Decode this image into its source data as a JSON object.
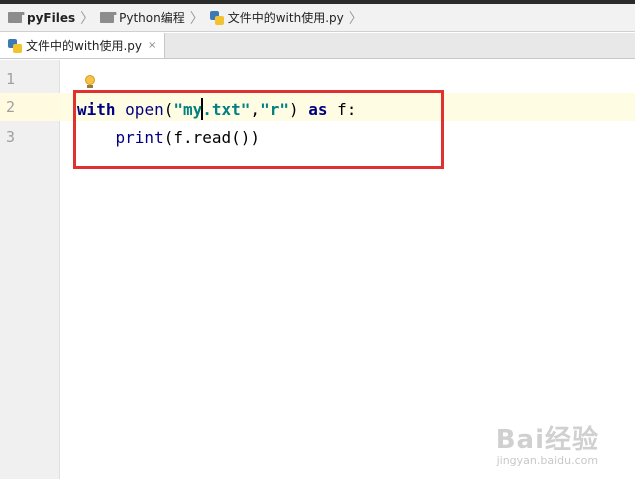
{
  "breadcrumb": {
    "items": [
      {
        "label": "pyFiles",
        "icon": "folder-icon"
      },
      {
        "label": "Python编程",
        "icon": "folder-icon"
      },
      {
        "label": "文件中的with使用.py",
        "icon": "python-file-icon"
      }
    ]
  },
  "tabs": [
    {
      "label": "文件中的with使用.py",
      "close": "×"
    }
  ],
  "editor": {
    "line_numbers": [
      "1",
      "2",
      "3"
    ],
    "line2": {
      "kw_with": "with",
      "fn_open": "open",
      "paren_open": "(",
      "str_part1": "\"my",
      "str_part2": ".txt\"",
      "comma": ",",
      "str_mode": "\"r\"",
      "paren_close": ")",
      "kw_as": "as",
      "var": "f:"
    },
    "line3": {
      "indent": "    ",
      "fn_print": "print",
      "args": "(f.read())"
    }
  },
  "watermark": {
    "logo": "Bai经验",
    "sub": "jingyan.baidu.com"
  },
  "colors": {
    "keyword": "#000080",
    "string": "#008080",
    "highlight_box": "#e03030",
    "current_line": "#fffce4"
  }
}
